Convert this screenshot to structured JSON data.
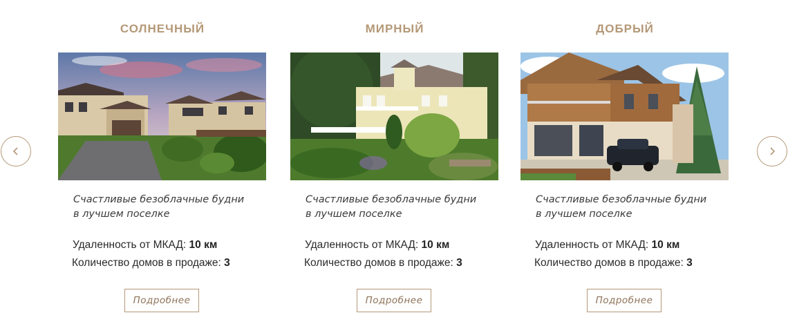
{
  "nav": {
    "prev_icon": "chevron-left-icon",
    "next_icon": "chevron-right-icon"
  },
  "theme": {
    "accent": "#b49877",
    "text": "#2e2e2e"
  },
  "cards": [
    {
      "title": "СОЛНЕЧНЫЙ",
      "tagline_line1": "Счастливые безоблачные будни",
      "tagline_line2": "в лучшем поселке",
      "distance_label": "Удаленность от МКАД:",
      "distance_value": "10 км",
      "houses_label": "Количество домов в продаже:",
      "houses_value": "3",
      "button_label": "Подробнее"
    },
    {
      "title": "МИРНЫЙ",
      "tagline_line1": "Счастливые безоблачные будни",
      "tagline_line2": "в лучшем поселке",
      "distance_label": "Удаленность от МКАД:",
      "distance_value": "10 км",
      "houses_label": "Количество домов в продаже:",
      "houses_value": "3",
      "button_label": "Подробнее"
    },
    {
      "title": "ДОБРЫЙ",
      "tagline_line1": "Счастливые безоблачные будни",
      "tagline_line2": "в лучшем поселке",
      "distance_label": "Удаленность от МКАД:",
      "distance_value": "10 км",
      "houses_label": "Количество домов в продаже:",
      "houses_value": "3",
      "button_label": "Подробнее"
    }
  ]
}
